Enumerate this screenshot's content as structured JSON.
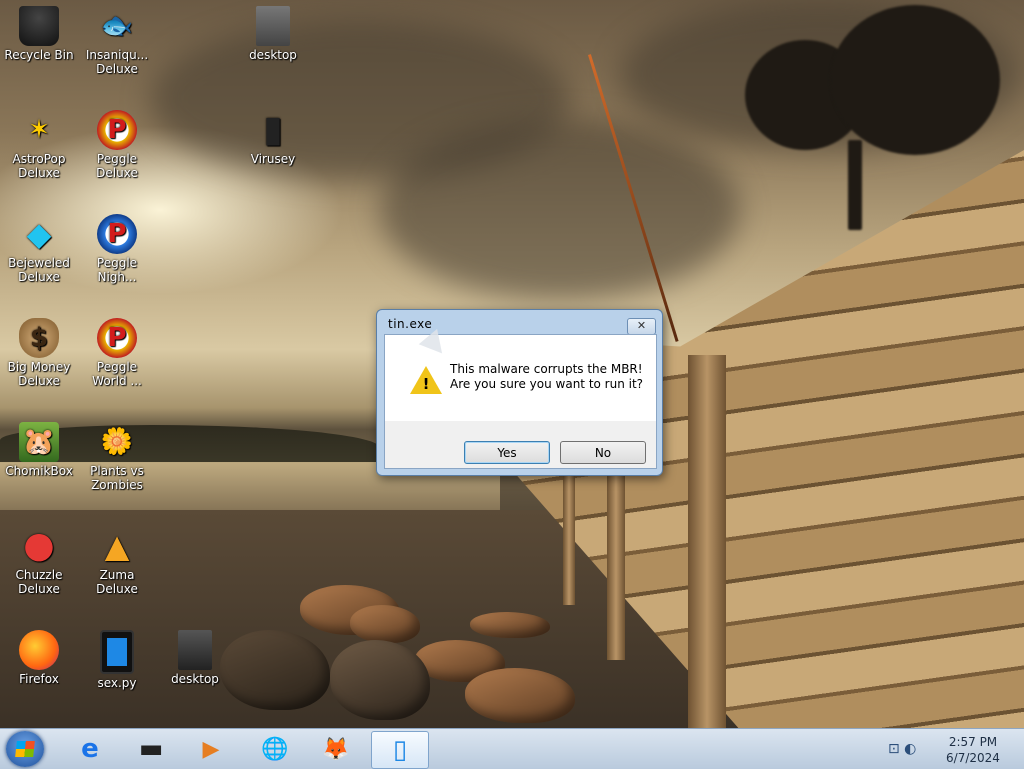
{
  "desktop_icons": [
    {
      "name": "icon-recycle-bin",
      "label": "Recycle Bin",
      "glyph": "🗑"
    },
    {
      "name": "icon-insaniquarium",
      "label": "Insaniqu...\nDeluxe",
      "glyph": "🐟"
    },
    {
      "name": "icon-desktop-file",
      "label": "desktop",
      "glyph": "📄"
    },
    {
      "name": "icon-astropop",
      "label": "AstroPop\nDeluxe",
      "glyph": "✶"
    },
    {
      "name": "icon-peggle-deluxe",
      "label": "Peggle\nDeluxe",
      "glyph": "P"
    },
    {
      "name": "icon-virusey",
      "label": "Virusey",
      "glyph": "▮"
    },
    {
      "name": "icon-bejeweled",
      "label": "Bejeweled\nDeluxe",
      "glyph": "◆"
    },
    {
      "name": "icon-peggle-nights",
      "label": "Peggle\nNigh...",
      "glyph": "P"
    },
    {
      "name": "icon-big-money",
      "label": "Big Money\nDeluxe",
      "glyph": "$"
    },
    {
      "name": "icon-peggle-world",
      "label": "Peggle\nWorld ...",
      "glyph": "P"
    },
    {
      "name": "icon-chomikbox",
      "label": "ChomikBox",
      "glyph": "🐹"
    },
    {
      "name": "icon-plants-vs-zombies",
      "label": "Plants vs\nZombies",
      "glyph": "🌼"
    },
    {
      "name": "icon-chuzzle",
      "label": "Chuzzle\nDeluxe",
      "glyph": "●"
    },
    {
      "name": "icon-zuma",
      "label": "Zuma\nDeluxe",
      "glyph": "▲"
    },
    {
      "name": "icon-firefox",
      "label": "Firefox",
      "glyph": "🦊"
    },
    {
      "name": "icon-sex-py",
      "label": "sex.py",
      "glyph": "▯"
    },
    {
      "name": "icon-desktop-file-2",
      "label": "desktop",
      "glyph": "📄"
    }
  ],
  "dialog": {
    "title": "tin.exe",
    "close_label": "✕",
    "message_line1": "This malware corrupts the MBR!",
    "message_line2": "Are you sure you want to run it?",
    "yes_label": "Yes",
    "no_label": "No",
    "warning_mark": "!"
  },
  "taskbar": {
    "apps": [
      {
        "name": "taskbar-internet-explorer",
        "glyph": "e"
      },
      {
        "name": "taskbar-virusey",
        "glyph": "▬"
      },
      {
        "name": "taskbar-media-player",
        "glyph": "▶"
      },
      {
        "name": "taskbar-globe",
        "glyph": "🌐"
      },
      {
        "name": "taskbar-firefox",
        "glyph": "🦊"
      },
      {
        "name": "taskbar-sex-py",
        "glyph": "▯"
      }
    ],
    "tray_icons": "⊡ ◐",
    "time": "2:57 PM",
    "date": "6/7/2024"
  },
  "colors": {
    "dialog_frame": "#b9d1ea",
    "taskbar": "#dbe5f0",
    "warning": "#f0c419"
  }
}
